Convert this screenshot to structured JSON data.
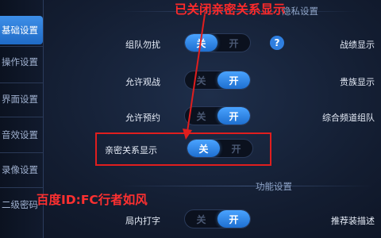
{
  "sidebar": {
    "items": [
      {
        "label": "基础设置",
        "active": true
      },
      {
        "label": "操作设置",
        "active": false
      },
      {
        "label": "界面设置",
        "active": false
      },
      {
        "label": "音效设置",
        "active": false
      },
      {
        "label": "录像设置",
        "active": false
      },
      {
        "label": "二级密码",
        "active": false
      }
    ]
  },
  "sections": {
    "top_title": "隐私设置",
    "function_title": "功能设置"
  },
  "toggle_labels": {
    "off": "关",
    "on": "开"
  },
  "rows": [
    {
      "label": "组队勿扰",
      "state": "off",
      "right_label": "战绩显示"
    },
    {
      "label": "允许观战",
      "state": "on",
      "right_label": "贵族显示"
    },
    {
      "label": "允许预约",
      "state": "on",
      "right_label": "综合频道组队"
    },
    {
      "label": "亲密关系显示",
      "state": "off",
      "right_label": ""
    },
    {
      "label": "局内打字",
      "state": "on",
      "right_label": "推荐装描述"
    }
  ],
  "help_icon": {
    "icon": "question-icon",
    "glyph": "?"
  },
  "annotation": {
    "text": "已关闭亲密关系显示",
    "color": "#ff2a2a"
  },
  "watermark": {
    "text": "百度ID:FC行者如风",
    "color": "#ff3030"
  },
  "colors": {
    "accent": "#2f7fe0",
    "highlight": "#e01e1e"
  }
}
